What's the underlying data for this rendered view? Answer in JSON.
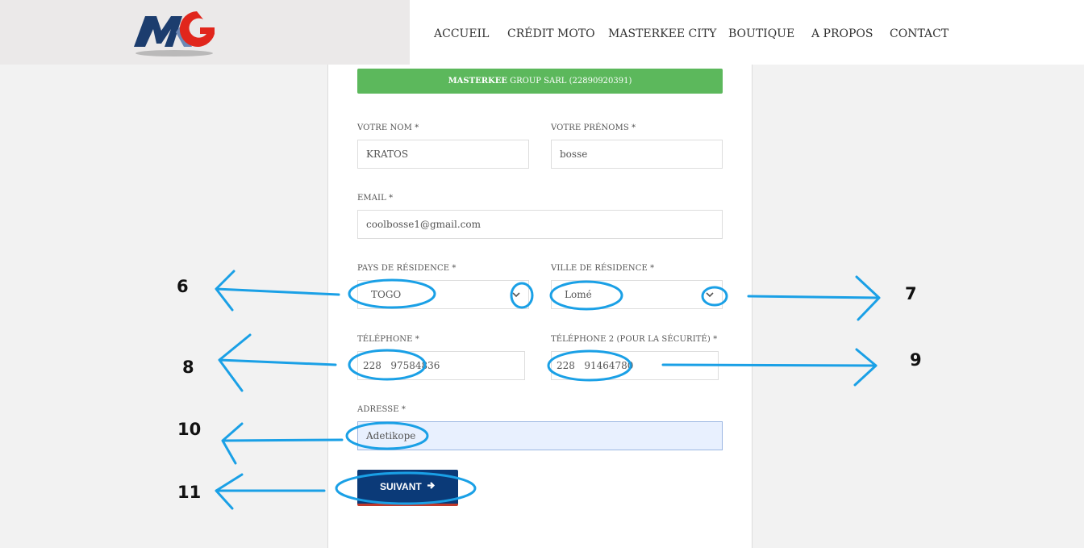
{
  "logo": {
    "text": "MKG",
    "colors": {
      "navy": "#1c3d6e",
      "red": "#e1261c"
    }
  },
  "nav": {
    "items": [
      "ACCUEIL",
      "CRÉDIT MOTO",
      "MASTERKEE CITY",
      "BOUTIQUE",
      "A PROPOS",
      "CONTACT"
    ]
  },
  "banner": {
    "bold": "MASTERKEE",
    "rest": " GROUP SARL (22890920391)"
  },
  "form": {
    "nom": {
      "label": "VOTRE NOM *",
      "value": "KRATOS"
    },
    "prenoms": {
      "label": "VOTRE PRÉNOMS *",
      "value": "bosse"
    },
    "email": {
      "label": "EMAIL *",
      "value": "coolbosse1@gmail.com"
    },
    "pays": {
      "label": "PAYS DE RÉSIDENCE *",
      "value": "TOGO"
    },
    "ville": {
      "label": "VILLE DE RÉSIDENCE *",
      "value": "Lomé"
    },
    "telephone": {
      "label": "TÉLÉPHONE *",
      "prefix": "228",
      "value": "97584836"
    },
    "telephone2": {
      "label": "TÉLÉPHONE 2 (POUR LA SÉCURITÉ) *",
      "prefix": "228",
      "value": "91464780"
    },
    "adresse": {
      "label": "ADRESSE *",
      "value": "Adetikope"
    },
    "submit": {
      "label": "SUIVANT",
      "icon": "arrow-right-icon"
    }
  },
  "annotations": {
    "numbers": [
      "6",
      "7",
      "8",
      "9",
      "10",
      "11"
    ],
    "color": "#1aa0e6"
  },
  "colors": {
    "banner": "#5cb85c",
    "button": "#0b3a78",
    "button_border": "#c0392b"
  }
}
